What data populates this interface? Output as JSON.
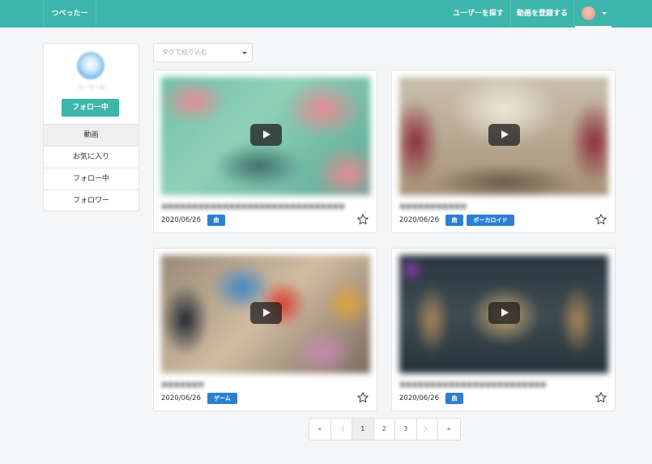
{
  "navbar": {
    "brand": "つべったー",
    "find_users": "ユーザーを探す",
    "register_video": "動画を登録する"
  },
  "sidebar": {
    "follow_button": "フォロー中",
    "menu": [
      "動画",
      "お気に入り",
      "フォロー中",
      "フォロワー"
    ]
  },
  "filter": {
    "placeholder": "タグで絞り込む"
  },
  "videos": [
    {
      "date": "2020/06/26",
      "tags": [
        "曲"
      ]
    },
    {
      "date": "2020/06/26",
      "tags": [
        "曲",
        "ボーカロイド"
      ]
    },
    {
      "date": "2020/06/26",
      "tags": [
        "ゲーム"
      ]
    },
    {
      "date": "2020/06/26",
      "tags": [
        "曲"
      ]
    }
  ],
  "pagination": {
    "first": "«",
    "prev": "〈",
    "pages": [
      "1",
      "2",
      "3"
    ],
    "next": "〉",
    "last": "»",
    "current": "1"
  },
  "colors": {
    "brand": "#3db5aa",
    "tag": "#2d7fd3"
  }
}
